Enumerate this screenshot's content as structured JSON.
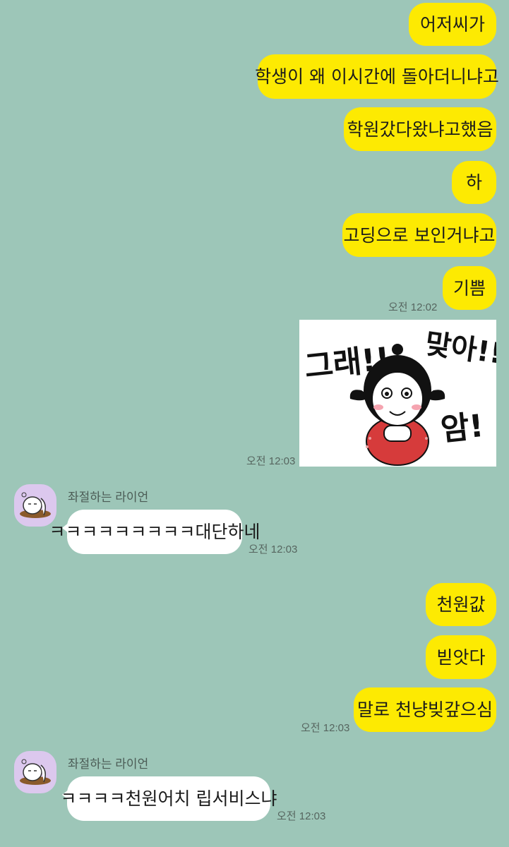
{
  "chat": {
    "messages_out_1": [
      "어저씨가",
      "학생이 왜 이시간에 돌아더니냐고",
      "학원갔다왔냐고했음",
      "하",
      "고딩으로 보인거냐고",
      "기쁨"
    ],
    "time_1": "오전 12:02",
    "sticker": {
      "text_left": "그래!!",
      "text_right_top": "맞아!!",
      "text_right_bottom": "암!"
    },
    "time_sticker": "오전 12:03",
    "incoming_1": {
      "sender": "좌절하는 라이언",
      "text": "ㅋㅋㅋㅋㅋㅋㅋㅋㅋ대단하네",
      "time": "오전 12:03"
    },
    "messages_out_2": [
      "천원값",
      "빋앗다",
      "말로 천냥빚갚으심"
    ],
    "time_2": "오전 12:03",
    "incoming_2": {
      "sender": "좌절하는 라이언",
      "text": "ㅋㅋㅋㅋ천원어치 립서비스냐",
      "time": "오전 12:03"
    }
  },
  "colors": {
    "background": "#9dc6b8",
    "outgoing_bubble": "#fdea02",
    "incoming_bubble": "#ffffff",
    "avatar_bg": "#dcc8ee"
  }
}
